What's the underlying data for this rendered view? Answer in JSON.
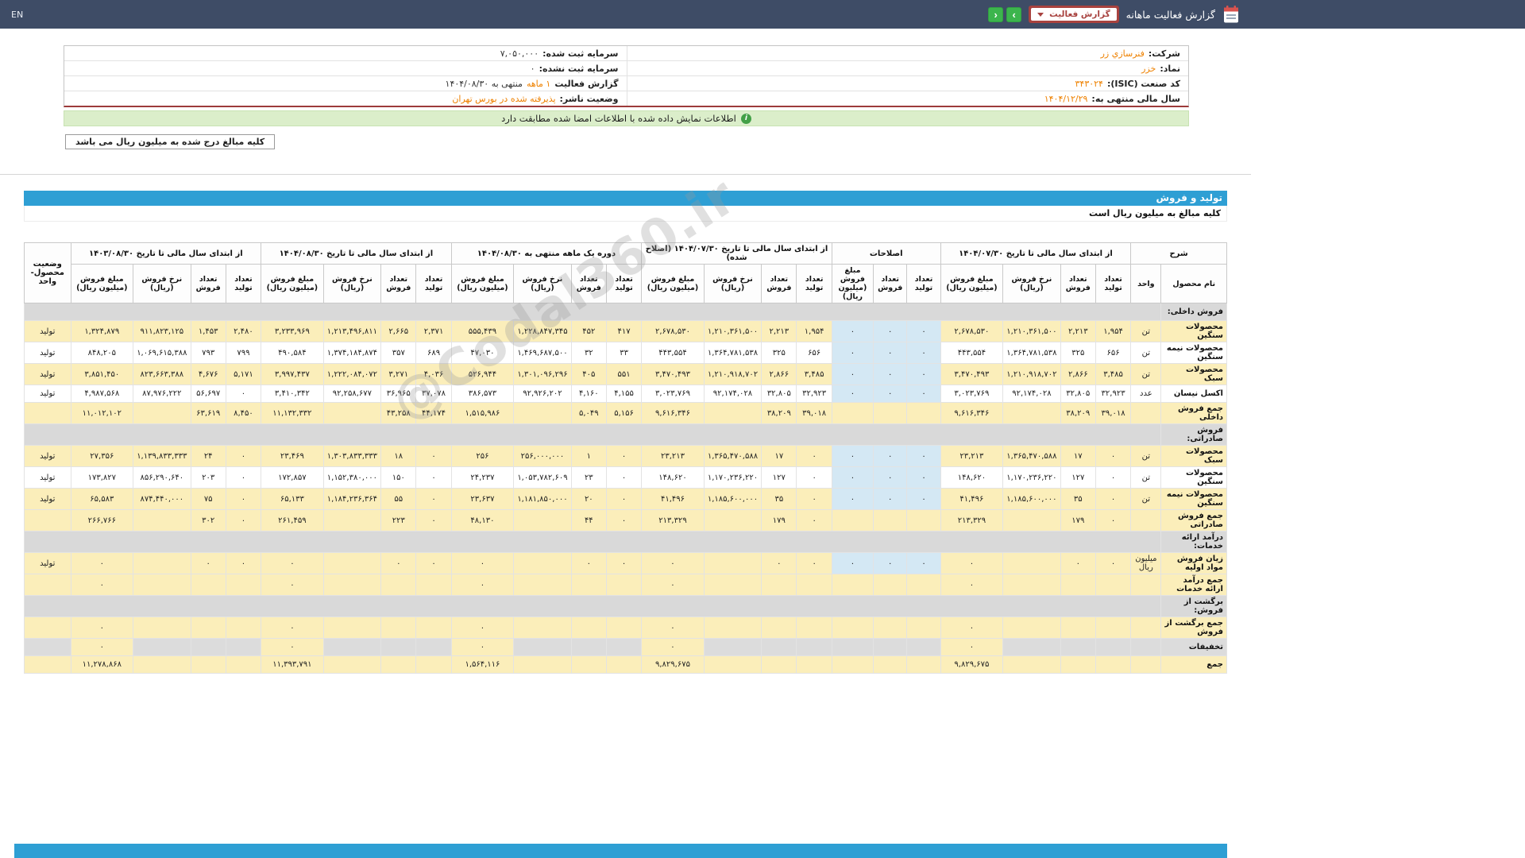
{
  "topbar": {
    "lang": "EN",
    "title": "گزارش فعالیت ماهانه",
    "dropdown_value": "گزارش فعالیت",
    "nav_next": "›",
    "nav_prev": "‹"
  },
  "company": {
    "right_rows": [
      {
        "label": "شرکت:",
        "value": "فنرسازي زر"
      },
      {
        "label": "نماد:",
        "value": "خزر"
      },
      {
        "label": "کد صنعت (ISIC):",
        "value": "۳۴۳۰۲۴"
      },
      {
        "label": "سال مالی منتهی به:",
        "value": "۱۴۰۴/۱۲/۲۹"
      }
    ],
    "left_rows": [
      {
        "label": "سرمایه ثبت شده:",
        "value": "۷,۰۵۰,۰۰۰"
      },
      {
        "label": "سرمایه ثبت نشده:",
        "value": "۰"
      },
      {
        "label": "گزارش فعالیت",
        "value": "۱ ماهه",
        "suffix": "منتهی به ۱۴۰۴/۰۸/۳۰"
      },
      {
        "label": "وضعیت ناشر:",
        "value": "پذیرفته شده در بورس تهران"
      }
    ]
  },
  "info_bar": {
    "text": "اطلاعات نمایش داده شده با اطلاعات امضا شده مطابقت دارد"
  },
  "notes": {
    "units_note": "کلیه مبالغ درج شده به میلیون ریال می باشد"
  },
  "watermark": "@Codal360.ir",
  "table": {
    "section_title": "تولید و فروش",
    "amounts_note": "کلیه مبالغ به میلیون ریال است",
    "header": {
      "sharh": "شرح",
      "product": "نام محصول",
      "unit": "واحد",
      "status": "وضعیت محصول-واحد",
      "groups": [
        {
          "title": "از ابتدای سال مالی تا تاریخ ۱۴۰۴/۰۷/۳۰",
          "cols": [
            "تعداد تولید",
            "تعداد فروش",
            "نرخ فروش (ریال)",
            "مبلغ فروش (میلیون ریال)"
          ]
        },
        {
          "title": "اصلاحات",
          "cols": [
            "تعداد تولید",
            "تعداد فروش",
            "مبلغ فروش (میلیون ریال)"
          ]
        },
        {
          "title": "از ابتدای سال مالی تا تاریخ ۱۴۰۴/۰۷/۳۰ (اصلاح شده)",
          "cols": [
            "تعداد تولید",
            "تعداد فروش",
            "نرخ فروش (ریال)",
            "مبلغ فروش (میلیون ریال)"
          ]
        },
        {
          "title": "دوره یک ماهه منتهی به ۱۴۰۴/۰۸/۳۰",
          "cols": [
            "تعداد تولید",
            "تعداد فروش",
            "نرخ فروش (ریال)",
            "مبلغ فروش (میلیون ریال)"
          ]
        },
        {
          "title": "از ابتدای سال مالی تا تاریخ ۱۴۰۴/۰۸/۳۰",
          "cols": [
            "تعداد تولید",
            "تعداد فروش",
            "نرخ فروش (ریال)",
            "مبلغ فروش (میلیون ریال)"
          ]
        },
        {
          "title": "از ابتدای سال مالی تا تاریخ ۱۴۰۳/۰۸/۳۰",
          "cols": [
            "تعداد تولید",
            "تعداد فروش",
            "نرخ فروش (ریال)",
            "مبلغ فروش (میلیون ریال)"
          ]
        }
      ]
    },
    "rows": [
      {
        "type": "section",
        "name": "فروش داخلی:"
      },
      {
        "type": "data",
        "name": "محصولات سنگین",
        "unit": "تن",
        "status": "تولید",
        "cells": [
          "۱,۹۵۴",
          "۲,۲۱۳",
          "۱,۲۱۰,۳۶۱,۵۰۰",
          "۲,۶۷۸,۵۳۰",
          "۰",
          "۰",
          "۰",
          "۱,۹۵۴",
          "۲,۲۱۳",
          "۱,۲۱۰,۳۶۱,۵۰۰",
          "۲,۶۷۸,۵۳۰",
          "۴۱۷",
          "۴۵۲",
          "۱,۲۲۸,۸۴۷,۳۴۵",
          "۵۵۵,۴۳۹",
          "۲,۳۷۱",
          "۲,۶۶۵",
          "۱,۲۱۳,۴۹۶,۸۱۱",
          "۳,۲۳۳,۹۶۹",
          "۲,۴۸۰",
          "۱,۴۵۳",
          "۹۱۱,۸۲۳,۱۲۵",
          "۱,۳۲۴,۸۷۹"
        ]
      },
      {
        "type": "dataAlt",
        "name": "محصولات نیمه سنگین",
        "unit": "تن",
        "status": "تولید",
        "cells": [
          "۶۵۶",
          "۳۲۵",
          "۱,۳۶۴,۷۸۱,۵۳۸",
          "۴۴۳,۵۵۴",
          "۰",
          "۰",
          "۰",
          "۶۵۶",
          "۳۲۵",
          "۱,۳۶۴,۷۸۱,۵۳۸",
          "۴۴۳,۵۵۴",
          "۳۳",
          "۳۲",
          "۱,۴۶۹,۶۸۷,۵۰۰",
          "۴۷,۰۳۰",
          "۶۸۹",
          "۳۵۷",
          "۱,۳۷۴,۱۸۴,۸۷۴",
          "۴۹۰,۵۸۴",
          "۷۹۹",
          "۷۹۳",
          "۱,۰۶۹,۶۱۵,۳۸۸",
          "۸۴۸,۲۰۵"
        ]
      },
      {
        "type": "data",
        "name": "محصولات سبک",
        "unit": "تن",
        "status": "تولید",
        "cells": [
          "۳,۴۸۵",
          "۲,۸۶۶",
          "۱,۲۱۰,۹۱۸,۷۰۲",
          "۳,۴۷۰,۴۹۳",
          "۰",
          "۰",
          "۰",
          "۳,۴۸۵",
          "۲,۸۶۶",
          "۱,۲۱۰,۹۱۸,۷۰۲",
          "۳,۴۷۰,۴۹۳",
          "۵۵۱",
          "۴۰۵",
          "۱,۳۰۱,۰۹۶,۲۹۶",
          "۵۲۶,۹۴۴",
          "۴,۰۳۶",
          "۳,۲۷۱",
          "۱,۲۲۲,۰۸۴,۰۷۲",
          "۳,۹۹۷,۴۳۷",
          "۵,۱۷۱",
          "۴,۶۷۶",
          "۸۲۳,۶۶۳,۳۸۸",
          "۳,۸۵۱,۴۵۰"
        ]
      },
      {
        "type": "dataAlt",
        "name": "اکسل نیسان",
        "unit": "عدد",
        "status": "تولید",
        "cells": [
          "۳۲,۹۲۳",
          "۳۲,۸۰۵",
          "۹۲,۱۷۴,۰۲۸",
          "۳,۰۲۳,۷۶۹",
          "۰",
          "۰",
          "۰",
          "۳۲,۹۲۳",
          "۳۲,۸۰۵",
          "۹۲,۱۷۴,۰۲۸",
          "۳,۰۲۳,۷۶۹",
          "۴,۱۵۵",
          "۴,۱۶۰",
          "۹۲,۹۲۶,۲۰۲",
          "۳۸۶,۵۷۳",
          "۳۷,۰۷۸",
          "۳۶,۹۶۵",
          "۹۲,۲۵۸,۶۷۷",
          "۳,۴۱۰,۳۴۲",
          "۰",
          "۵۶,۶۹۷",
          "۸۷,۹۷۶,۲۲۲",
          "۴,۹۸۷,۵۶۸"
        ]
      },
      {
        "type": "total",
        "name": "جمع فروش داخلی",
        "unit": "",
        "status": "",
        "cells": [
          "۳۹,۰۱۸",
          "۳۸,۲۰۹",
          "",
          "۹,۶۱۶,۳۴۶",
          "",
          "",
          "",
          "۳۹,۰۱۸",
          "۳۸,۲۰۹",
          "",
          "۹,۶۱۶,۳۴۶",
          "۵,۱۵۶",
          "۵,۰۴۹",
          "",
          "۱,۵۱۵,۹۸۶",
          "۴۴,۱۷۴",
          "۴۳,۲۵۸",
          "",
          "۱۱,۱۳۲,۳۳۲",
          "۸,۴۵۰",
          "۶۳,۶۱۹",
          "",
          "۱۱,۰۱۲,۱۰۲"
        ]
      },
      {
        "type": "section",
        "name": "فروش صادراتی:"
      },
      {
        "type": "data",
        "name": "محصولات سبک",
        "unit": "تن",
        "status": "تولید",
        "cells": [
          "۰",
          "۱۷",
          "۱,۳۶۵,۴۷۰,۵۸۸",
          "۲۳,۲۱۳",
          "۰",
          "۰",
          "۰",
          "۰",
          "۱۷",
          "۱,۳۶۵,۴۷۰,۵۸۸",
          "۲۳,۲۱۳",
          "۰",
          "۱",
          "۲۵۶,۰۰۰,۰۰۰",
          "۲۵۶",
          "۰",
          "۱۸",
          "۱,۳۰۳,۸۳۳,۳۳۳",
          "۲۳,۴۶۹",
          "۰",
          "۲۴",
          "۱,۱۳۹,۸۳۳,۳۳۳",
          "۲۷,۳۵۶"
        ]
      },
      {
        "type": "dataAlt",
        "name": "محصولات سنگین",
        "unit": "تن",
        "status": "تولید",
        "cells": [
          "۰",
          "۱۲۷",
          "۱,۱۷۰,۲۳۶,۲۲۰",
          "۱۴۸,۶۲۰",
          "۰",
          "۰",
          "۰",
          "۰",
          "۱۲۷",
          "۱,۱۷۰,۲۳۶,۲۲۰",
          "۱۴۸,۶۲۰",
          "۰",
          "۲۳",
          "۱,۰۵۳,۷۸۲,۶۰۹",
          "۲۴,۲۳۷",
          "۰",
          "۱۵۰",
          "۱,۱۵۲,۳۸۰,۰۰۰",
          "۱۷۲,۸۵۷",
          "۰",
          "۲۰۳",
          "۸۵۶,۲۹۰,۶۴۰",
          "۱۷۳,۸۲۷"
        ]
      },
      {
        "type": "data",
        "name": "محصولات نیمه سنگین",
        "unit": "تن",
        "status": "تولید",
        "cells": [
          "۰",
          "۳۵",
          "۱,۱۸۵,۶۰۰,۰۰۰",
          "۴۱,۴۹۶",
          "۰",
          "۰",
          "۰",
          "۰",
          "۳۵",
          "۱,۱۸۵,۶۰۰,۰۰۰",
          "۴۱,۴۹۶",
          "۰",
          "۲۰",
          "۱,۱۸۱,۸۵۰,۰۰۰",
          "۲۳,۶۳۷",
          "۰",
          "۵۵",
          "۱,۱۸۴,۲۳۶,۳۶۴",
          "۶۵,۱۳۳",
          "۰",
          "۷۵",
          "۸۷۴,۴۴۰,۰۰۰",
          "۶۵,۵۸۳"
        ]
      },
      {
        "type": "total",
        "name": "جمع فروش صادراتی",
        "unit": "",
        "status": "",
        "cells": [
          "۰",
          "۱۷۹",
          "",
          "۲۱۳,۳۲۹",
          "",
          "",
          "",
          "۰",
          "۱۷۹",
          "",
          "۲۱۳,۳۲۹",
          "۰",
          "۴۴",
          "",
          "۴۸,۱۳۰",
          "۰",
          "۲۲۳",
          "",
          "۲۶۱,۴۵۹",
          "۰",
          "۳۰۲",
          "",
          "۲۶۶,۷۶۶"
        ]
      },
      {
        "type": "section",
        "name": "درآمد ارائه خدمات:"
      },
      {
        "type": "data",
        "name": "زیان فروش مواد اولیه",
        "unit": "میلیون ریال",
        "status": "تولید",
        "cells": [
          "۰",
          "۰",
          "",
          "۰",
          "۰",
          "۰",
          "۰",
          "۰",
          "۰",
          "",
          "۰",
          "۰",
          "۰",
          "",
          "۰",
          "۰",
          "۰",
          "",
          "۰",
          "۰",
          "۰",
          "",
          "۰"
        ]
      },
      {
        "type": "total",
        "name": "جمع درآمد ارائه خدمات",
        "unit": "",
        "status": "",
        "cells": [
          "",
          "",
          "",
          "۰",
          "",
          "",
          "",
          "",
          "",
          "",
          "۰",
          "",
          "",
          "",
          "۰",
          "",
          "",
          "",
          "۰",
          "",
          "",
          "",
          "۰"
        ]
      },
      {
        "type": "section",
        "name": "برگشت از فروش:"
      },
      {
        "type": "total",
        "name": "جمع برگشت از فروش",
        "unit": "",
        "status": "",
        "cells": [
          "",
          "",
          "",
          "۰",
          "",
          "",
          "",
          "",
          "",
          "",
          "۰",
          "",
          "",
          "",
          "۰",
          "",
          "",
          "",
          "۰",
          "",
          "",
          "",
          "۰"
        ]
      },
      {
        "type": "discount",
        "name": "تخفیفات",
        "unit": "",
        "status": "",
        "cells": [
          "",
          "",
          "",
          "۰",
          "",
          "",
          "",
          "",
          "",
          "",
          "۰",
          "",
          "",
          "",
          "۰",
          "",
          "",
          "",
          "۰",
          "",
          "",
          "",
          "۰"
        ]
      },
      {
        "type": "total",
        "name": "جمع",
        "unit": "",
        "status": "",
        "cells": [
          "",
          "",
          "",
          "۹,۸۲۹,۶۷۵",
          "",
          "",
          "",
          "",
          "",
          "",
          "۹,۸۲۹,۶۷۵",
          "",
          "",
          "",
          "۱,۵۶۴,۱۱۶",
          "",
          "",
          "",
          "۱۱,۳۹۳,۷۹۱",
          "",
          "",
          "",
          "۱۱,۲۷۸,۸۶۸"
        ]
      }
    ]
  }
}
